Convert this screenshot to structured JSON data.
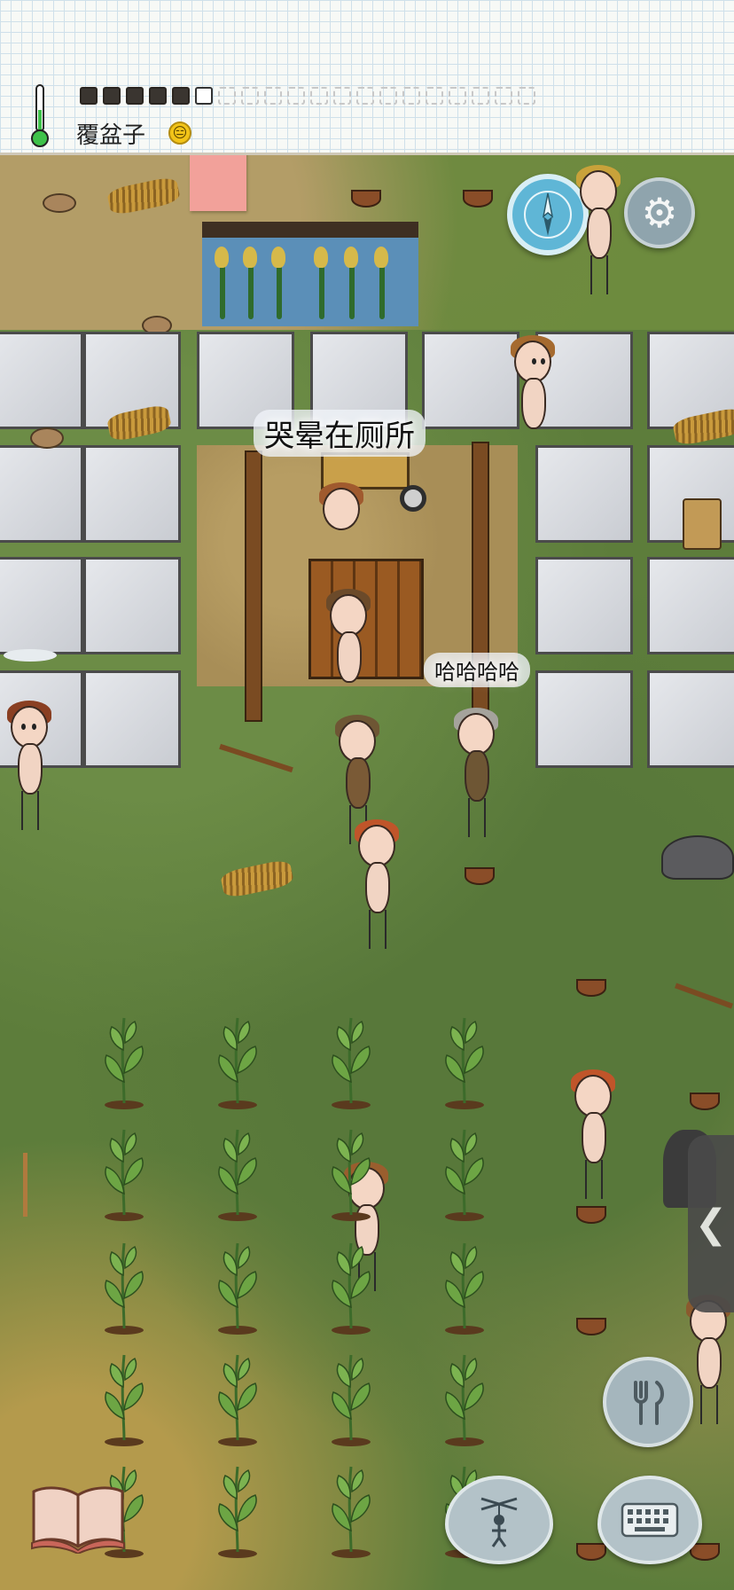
{
  "hud": {
    "food_label": "覆盆子",
    "food_emoji": "😑",
    "hunger_pips_filled": 6,
    "hunger_pips_total": 20
  },
  "world": {
    "speech_1": "哭晕在厕所",
    "speech_2": "哈哈哈哈"
  },
  "buttons": {
    "compass_icon": "compass-icon",
    "settings_icon": "gear-icon",
    "eat_icon": "fork-knife-icon",
    "emote_icon": "puppet-icon",
    "keyboard_icon": "keyboard-icon",
    "book_icon": "book-icon",
    "side_tab_glyph": "❮"
  },
  "colors": {
    "compass": "#5fb6d6",
    "grass": "#5d7d3b",
    "note_tag": "#f2a19a"
  }
}
